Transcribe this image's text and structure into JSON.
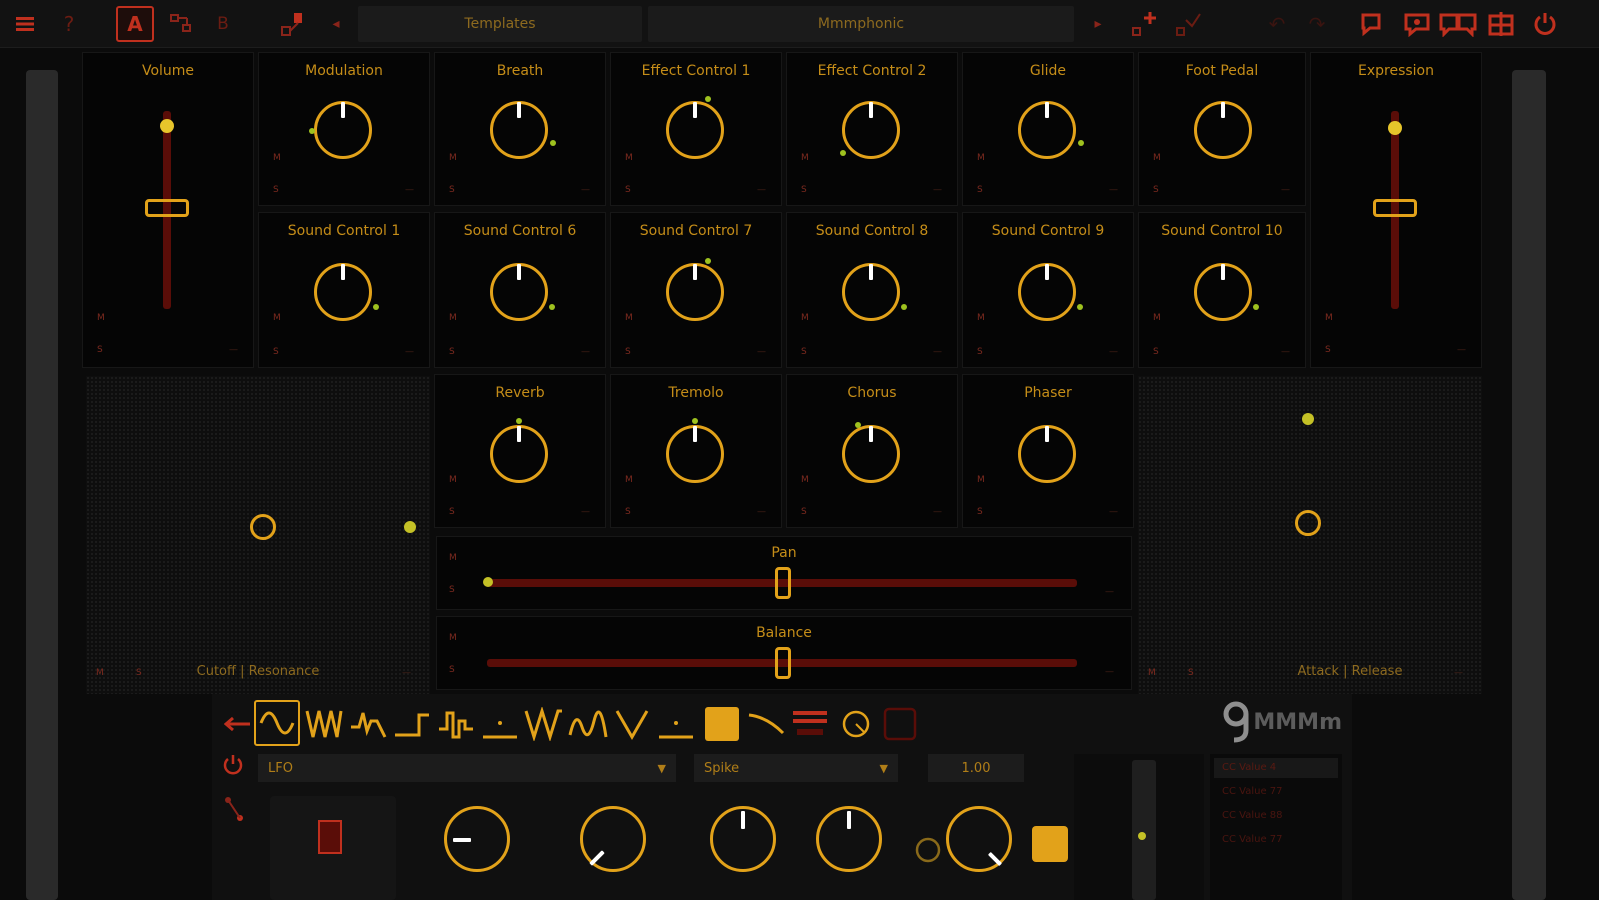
{
  "toolbar": {
    "template_field": "Templates",
    "preset_field": "Mmmphonic",
    "help_label": "?",
    "layout_a_label": "A",
    "layout_b_label": "B"
  },
  "controls": {
    "row1": [
      "Modulation",
      "Breath",
      "Effect Control 1",
      "Effect Control 2",
      "Glide",
      "Foot Pedal"
    ],
    "row2": [
      "Sound Control 1",
      "Sound Control 6",
      "Sound Control 7",
      "Sound Control 8",
      "Sound Control 9",
      "Sound Control 10"
    ],
    "row3": [
      "Reverb",
      "Tremolo",
      "Chorus",
      "Phaser"
    ],
    "volume": "Volume",
    "expression": "Expression",
    "pan": "Pan",
    "balance": "Balance",
    "xy_left": "Cutoff | Resonance",
    "xy_right": "Attack | Release",
    "m_tag": "M",
    "s_tag": "S",
    "dash": "—"
  },
  "lfo": {
    "mode": "LFO",
    "shape": "Spike",
    "rate_value": "1.00",
    "brand": "MMMm",
    "list_items": [
      "CC Value 4",
      "CC Value 77",
      "CC Value 88",
      "CC Value 77"
    ]
  },
  "colors": {
    "accent": "#e2a21a",
    "toolbar_red": "#c0301e",
    "track": "#5a0d08",
    "dot": "#c4c126"
  }
}
